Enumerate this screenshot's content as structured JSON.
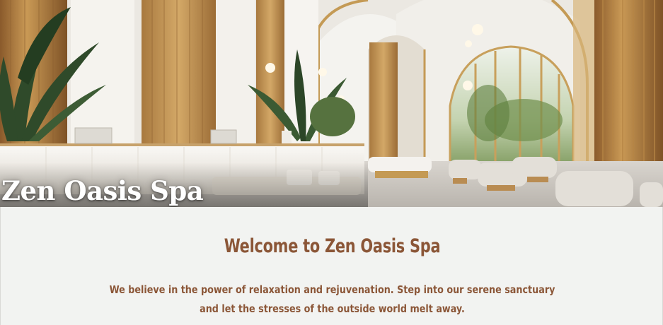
{
  "hero": {
    "title": "Zen Oasis Spa",
    "image": "spa-lobby-photo"
  },
  "welcome": {
    "heading": "Welcome to Zen Oasis Spa",
    "lines": [
      "We believe in the power of relaxation and rejuvenation. Step into our serene sanctuary",
      "and let the stresses of the outside world melt away."
    ]
  },
  "colors": {
    "accent_text": "#8b5637",
    "section_bg": "#f2f3f1",
    "hero_title": "#ffffff"
  }
}
